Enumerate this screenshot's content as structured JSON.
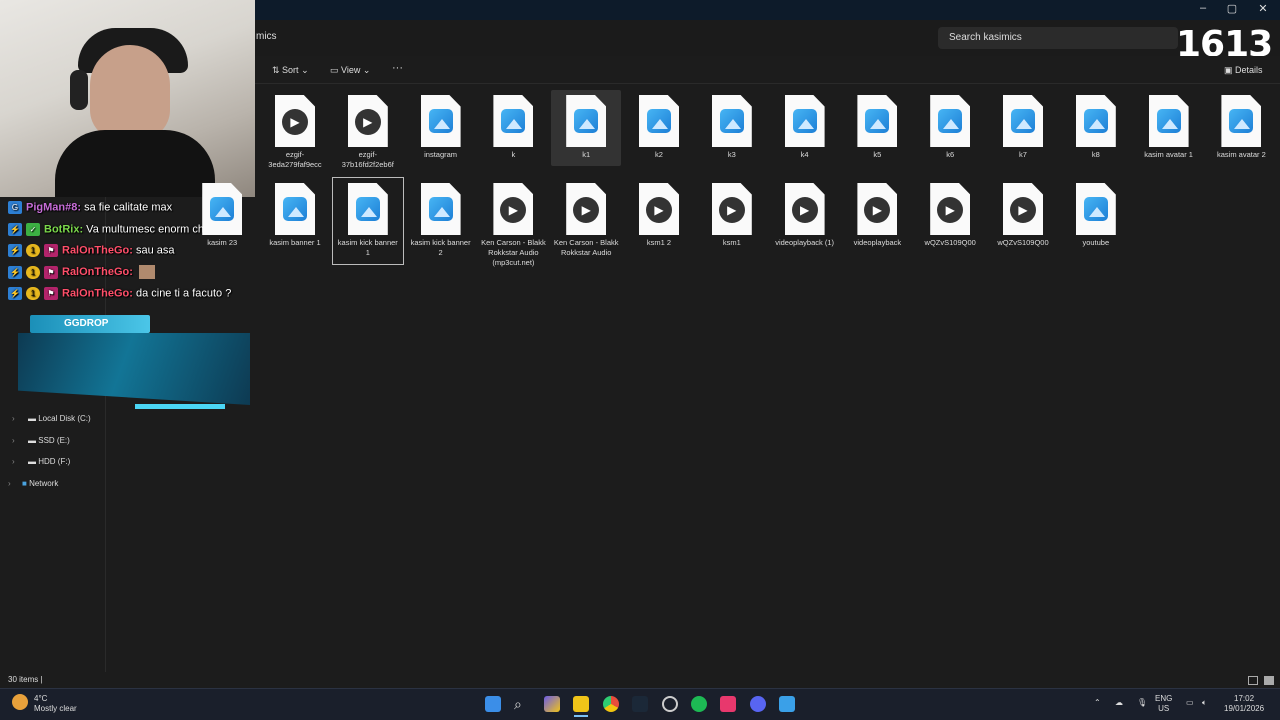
{
  "window": {
    "title_partial": "mics",
    "min": "–",
    "max": "▢",
    "close": "✕"
  },
  "search": {
    "placeholder": "Search kasimics"
  },
  "viewers": "1613",
  "toolbar": {
    "sort": "Sort",
    "view": "View",
    "more": "···",
    "details": "Details"
  },
  "sidebar": {
    "items": [
      {
        "label": "Local Disk (C:)"
      },
      {
        "label": "SSD (E:)"
      },
      {
        "label": "HDD (F:)"
      },
      {
        "label": "Network"
      }
    ]
  },
  "chat": [
    {
      "user": "PigMan#8:",
      "text": "sa fie calitate max",
      "user_color": "#c76dd8"
    },
    {
      "user": "BotRix:",
      "text": "Va multumesc enorm chat!!!",
      "user_color": "#7bd84b"
    },
    {
      "user": "RalOnTheGo:",
      "text": "sau asa",
      "user_color": "#ff4f6a"
    },
    {
      "user": "RalOnTheGo:",
      "text": "",
      "user_color": "#ff4f6a"
    },
    {
      "user": "RalOnTheGo:",
      "text": "da cine ti a facuto ?",
      "user_color": "#ff4f6a"
    }
  ],
  "ggdrop": {
    "label": "GGDROP"
  },
  "files": [
    {
      "name": "ezgif-3eda279faf9ecc",
      "type": "vid"
    },
    {
      "name": "ezgif-37b16fd2f2eb6f",
      "type": "vid"
    },
    {
      "name": "instagram",
      "type": "img"
    },
    {
      "name": "k",
      "type": "img"
    },
    {
      "name": "k1",
      "type": "img",
      "selected": true
    },
    {
      "name": "k2",
      "type": "img"
    },
    {
      "name": "k3",
      "type": "img"
    },
    {
      "name": "k4",
      "type": "img"
    },
    {
      "name": "k5",
      "type": "img"
    },
    {
      "name": "k6",
      "type": "img"
    },
    {
      "name": "k7",
      "type": "img"
    },
    {
      "name": "k8",
      "type": "img"
    },
    {
      "name": "kasim avatar 1",
      "type": "img"
    },
    {
      "name": "kasim avatar 2",
      "type": "img"
    },
    {
      "name": "kasim 23",
      "type": "img"
    },
    {
      "name": "kasim banner 1",
      "type": "img"
    },
    {
      "name": "kasim kick banner 1",
      "type": "img",
      "focused": true
    },
    {
      "name": "kasim kick banner 2",
      "type": "img"
    },
    {
      "name": "Ken Carson - Blakk Rokkstar Audio (mp3cut.net)",
      "type": "vid"
    },
    {
      "name": "Ken Carson - Blakk Rokkstar Audio",
      "type": "vid"
    },
    {
      "name": "ksm1 2",
      "type": "vid"
    },
    {
      "name": "ksm1",
      "type": "vid"
    },
    {
      "name": "videoplayback (1)",
      "type": "vid"
    },
    {
      "name": "videoplayback",
      "type": "vid"
    },
    {
      "name": "wQZvS109Q00",
      "type": "vid"
    },
    {
      "name": "wQZvS109Q00",
      "type": "vid"
    },
    {
      "name": "youtube",
      "type": "img"
    }
  ],
  "status": {
    "count": "30 items"
  },
  "weather": {
    "temp": "4°C",
    "desc": "Mostly clear"
  },
  "tray": {
    "lang1": "ENG",
    "lang2": "US",
    "time": "17:02",
    "date": "19/01/2026"
  }
}
